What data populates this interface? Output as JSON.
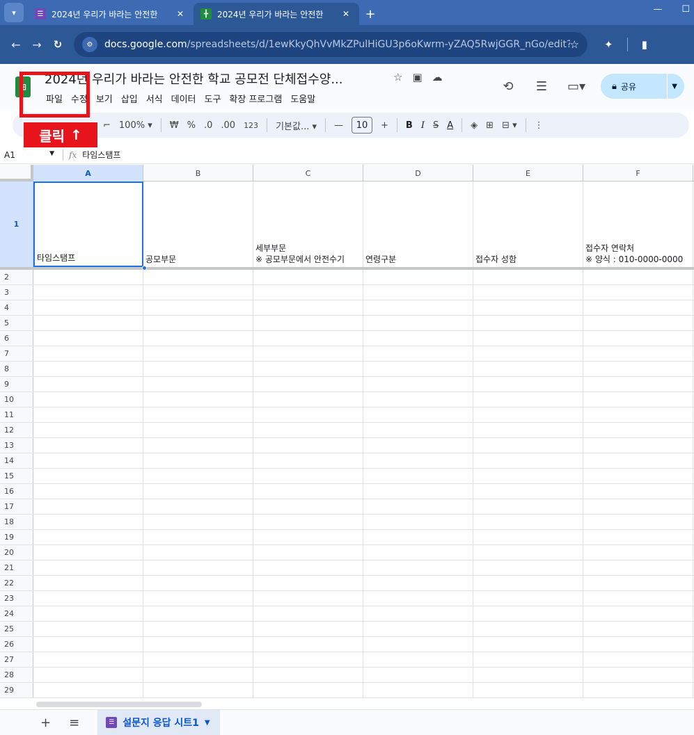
{
  "browser": {
    "tabs": [
      {
        "title": "2024년 우리가 바라는 안전한",
        "favicon": "forms-icon",
        "active": false
      },
      {
        "title": "2024년 우리가 바라는 안전한",
        "favicon": "sheets-icon",
        "active": true
      }
    ],
    "url_host": "docs.google.com",
    "url_path": "/spreadsheets/d/1ewKkyQhVvMkZPulHiGU3p6oKwrm-yZAQ5RwjGGR_nGo/edit?r..."
  },
  "doc": {
    "title": "2024년 우리가 바라는 안전한 학교 공모전 단체접수양...",
    "menu": [
      "파일",
      "수정",
      "보기",
      "삽입",
      "서식",
      "데이터",
      "도구",
      "확장 프로그램",
      "도움말"
    ],
    "share_label": "공유"
  },
  "toolbar": {
    "zoom": "100%",
    "currency": "₩",
    "percent": "%",
    "dec_decrease": ".0",
    "dec_increase": ".00",
    "number_format": "123",
    "font": "기본값...",
    "font_size": "10",
    "bold": "B",
    "italic": "I",
    "strike": "S",
    "text_color": "A"
  },
  "formula_bar": {
    "cell_ref": "A1",
    "content": "타임스탬프"
  },
  "grid": {
    "columns": [
      "A",
      "B",
      "C",
      "D",
      "E",
      "F"
    ],
    "header_row": {
      "row_num": "1",
      "cells": [
        {
          "line1": "",
          "line2": "타임스탬프"
        },
        {
          "line1": "",
          "line2": "공모부문"
        },
        {
          "line1": "세부부문",
          "line2": "※ 공모부문에서 안전수기"
        },
        {
          "line1": "",
          "line2": "연령구분"
        },
        {
          "line1": "",
          "line2": "접수자 성함"
        },
        {
          "line1": "접수자 연락처",
          "line2": "※ 양식 : 010-0000-0000"
        }
      ]
    },
    "row_numbers": [
      "2",
      "3",
      "4",
      "5",
      "6",
      "7",
      "8",
      "9",
      "10",
      "11",
      "12",
      "13",
      "14",
      "15",
      "16",
      "17",
      "18",
      "19",
      "20",
      "21",
      "22",
      "23",
      "24",
      "25",
      "26",
      "27",
      "28",
      "29"
    ]
  },
  "sheets": {
    "add_label": "+",
    "all_sheets_label": "≡",
    "active_sheet": "설문지 응답 시트1"
  },
  "annotation": {
    "label": "클릭",
    "arrow": "↑",
    "color": "#e8141c"
  }
}
